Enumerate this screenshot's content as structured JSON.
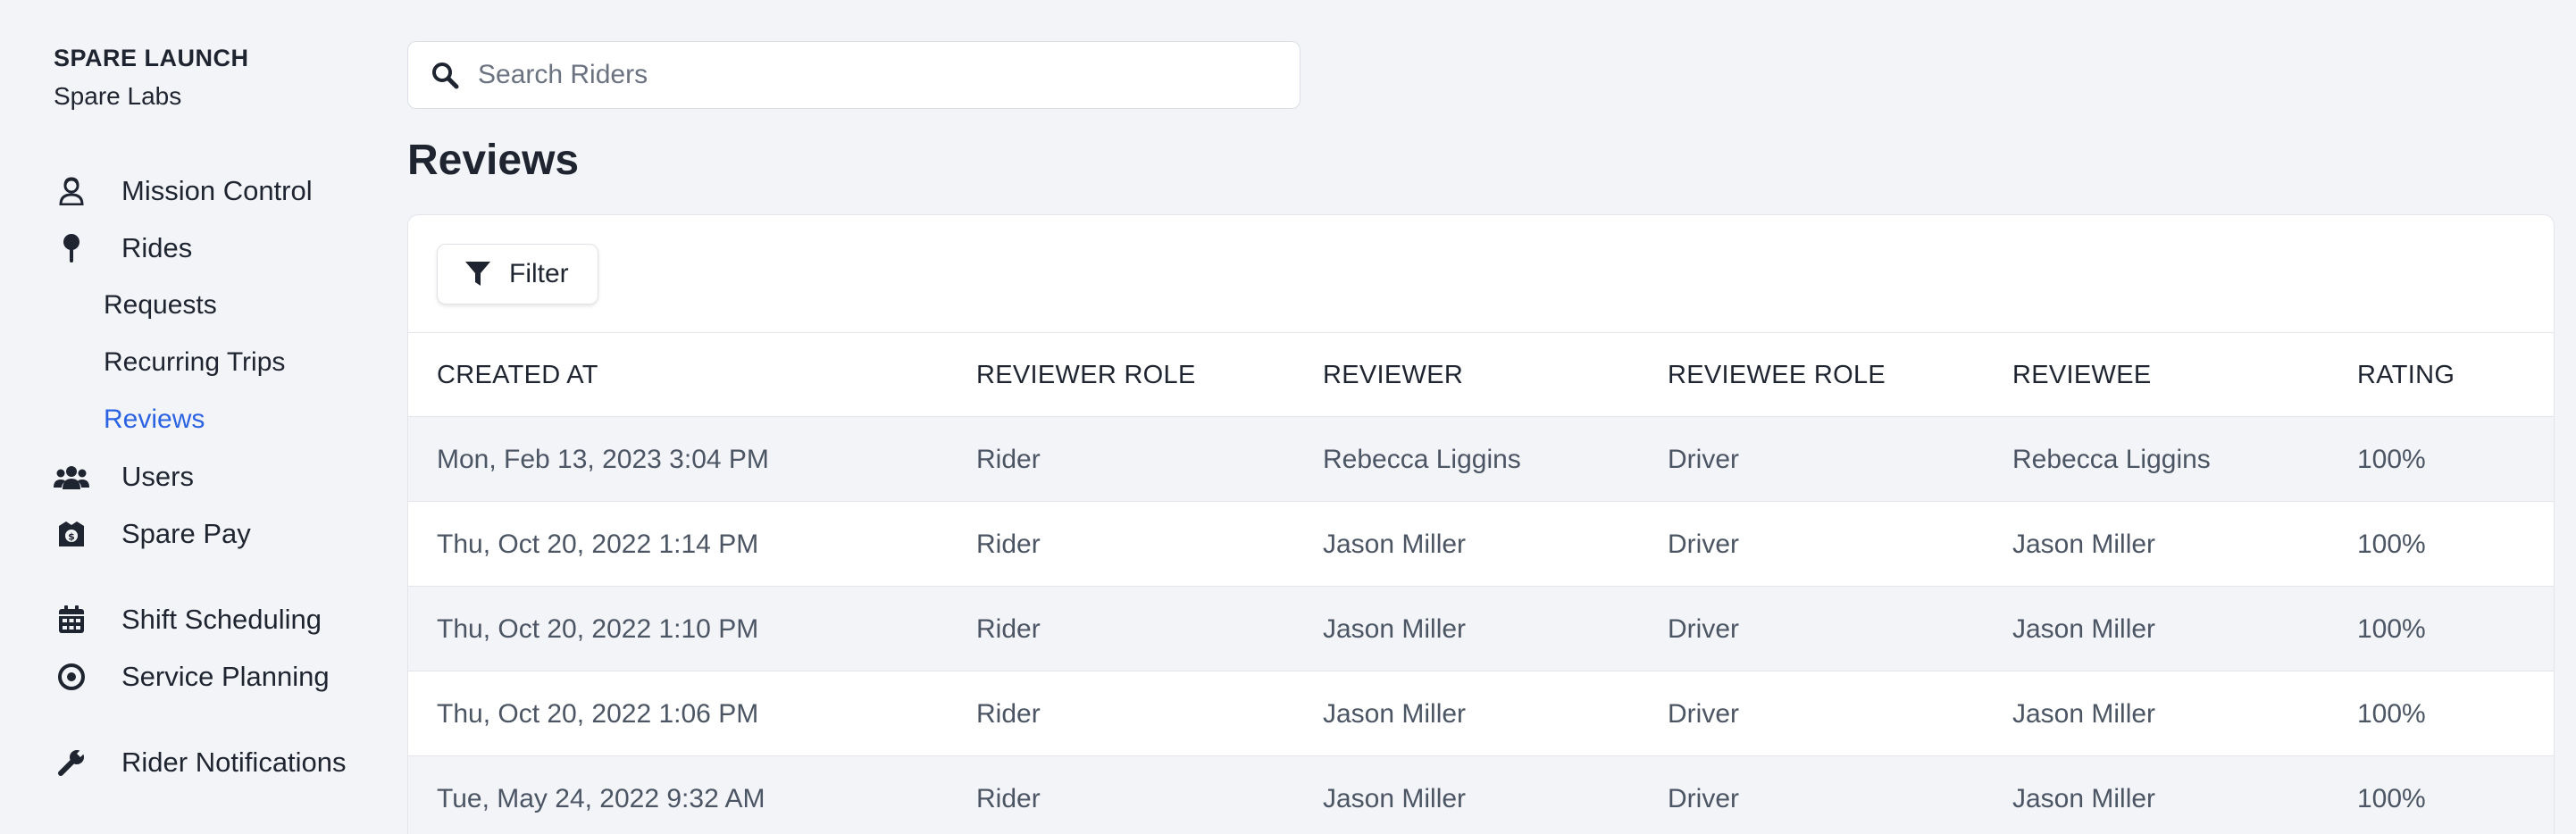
{
  "org": {
    "name": "SPARE LAUNCH",
    "sub": "Spare Labs"
  },
  "nav": {
    "mission_control": "Mission Control",
    "rides": "Rides",
    "requests": "Requests",
    "recurring_trips": "Recurring Trips",
    "reviews": "Reviews",
    "users": "Users",
    "spare_pay": "Spare Pay",
    "shift_scheduling": "Shift Scheduling",
    "service_planning": "Service Planning",
    "rider_notifications": "Rider Notifications"
  },
  "search": {
    "placeholder": "Search Riders",
    "value": ""
  },
  "page": {
    "title": "Reviews"
  },
  "toolbar": {
    "filter_label": "Filter"
  },
  "table": {
    "headers": [
      "CREATED AT",
      "REVIEWER ROLE",
      "REVIEWER",
      "REVIEWEE ROLE",
      "REVIEWEE",
      "RATING"
    ],
    "rows": [
      [
        "Mon, Feb 13, 2023 3:04 PM",
        "Rider",
        "Rebecca Liggins",
        "Driver",
        "Rebecca Liggins",
        "100%"
      ],
      [
        "Thu, Oct 20, 2022 1:14 PM",
        "Rider",
        "Jason Miller",
        "Driver",
        "Jason Miller",
        "100%"
      ],
      [
        "Thu, Oct 20, 2022 1:10 PM",
        "Rider",
        "Jason Miller",
        "Driver",
        "Jason Miller",
        "100%"
      ],
      [
        "Thu, Oct 20, 2022 1:06 PM",
        "Rider",
        "Jason Miller",
        "Driver",
        "Jason Miller",
        "100%"
      ],
      [
        "Tue, May 24, 2022 9:32 AM",
        "Rider",
        "Jason Miller",
        "Driver",
        "Jason Miller",
        "100%"
      ]
    ]
  },
  "colors": {
    "accent": "#2b63e3",
    "background": "#f3f4f8",
    "text": "#1f2530",
    "muted": "#4b5563"
  }
}
